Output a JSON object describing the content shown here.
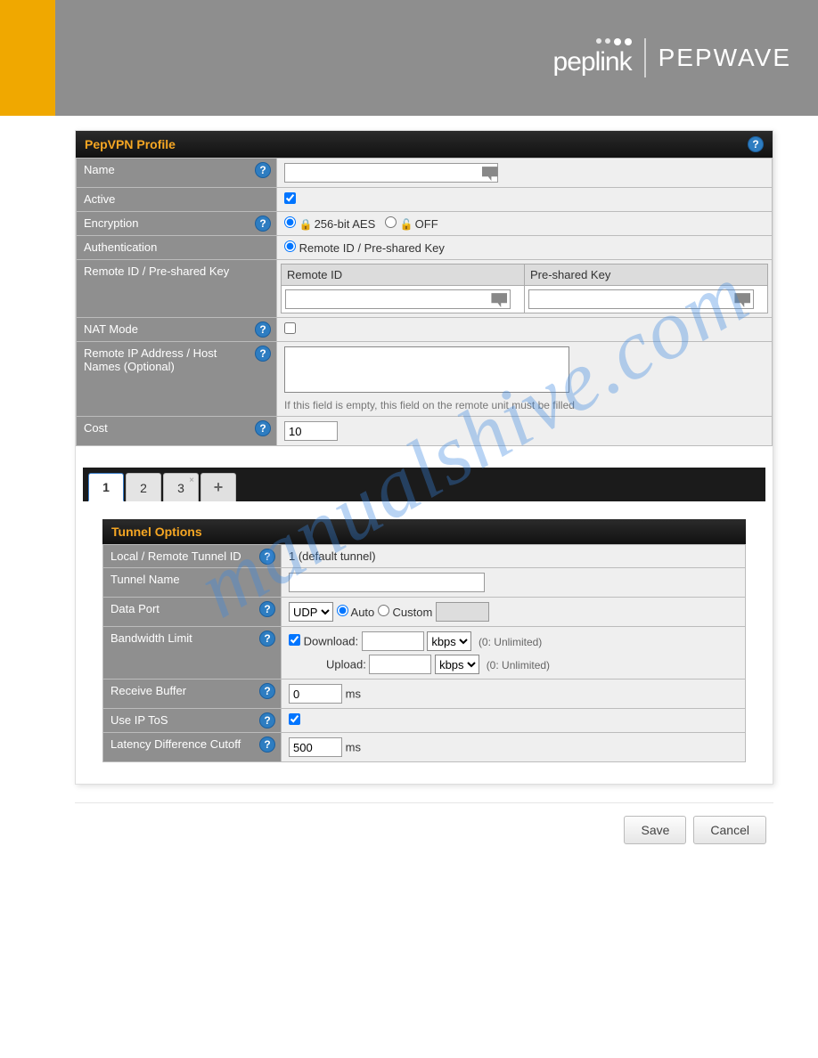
{
  "brand": {
    "peplink": "peplink",
    "pepwave": "PEPWAVE"
  },
  "profile": {
    "title": "PepVPN Profile",
    "labels": {
      "name": "Name",
      "active": "Active",
      "encryption": "Encryption",
      "authentication": "Authentication",
      "remote_psk": "Remote ID / Pre-shared Key",
      "nat_mode": "NAT Mode",
      "remote_ip": "Remote IP Address / Host Names (Optional)",
      "cost": "Cost"
    },
    "values": {
      "name": "",
      "active_checked": true,
      "encryption_aes_label": "256-bit AES",
      "encryption_off_label": "OFF",
      "encryption_selected": "aes",
      "auth_label": "Remote ID / Pre-shared Key",
      "remote_id_col": "Remote ID",
      "psk_col": "Pre-shared Key",
      "remote_id": "",
      "psk": "",
      "nat_checked": false,
      "remote_ip_text": "",
      "remote_ip_hint": "If this field is empty, this field on the remote unit must be filled",
      "cost": "10"
    }
  },
  "tabs": {
    "items": [
      "1",
      "2",
      "3"
    ],
    "active_index": 0,
    "closable_index": 2,
    "add_label": "+"
  },
  "tunnel": {
    "title": "Tunnel Options",
    "labels": {
      "tunnel_id": "Local / Remote Tunnel ID",
      "tunnel_name": "Tunnel Name",
      "data_port": "Data Port",
      "bandwidth": "Bandwidth Limit",
      "receive_buffer": "Receive Buffer",
      "ip_tos": "Use IP ToS",
      "latency": "Latency Difference Cutoff"
    },
    "values": {
      "tunnel_id_text": "1 (default tunnel)",
      "tunnel_name": "",
      "data_port_proto": "UDP",
      "data_port_mode": "auto",
      "data_port_auto_label": "Auto",
      "data_port_custom_label": "Custom",
      "data_port_custom_value": "",
      "bw_enabled": true,
      "bw_download_label": "Download:",
      "bw_download_value": "",
      "bw_download_unit": "kbps",
      "bw_upload_label": "Upload:",
      "bw_upload_value": "",
      "bw_upload_unit": "kbps",
      "bw_note": "(0: Unlimited)",
      "receive_buffer_value": "0",
      "receive_buffer_unit": "ms",
      "ip_tos_checked": true,
      "latency_value": "500",
      "latency_unit": "ms"
    }
  },
  "buttons": {
    "save": "Save",
    "cancel": "Cancel"
  },
  "watermark": "manualshive.com"
}
